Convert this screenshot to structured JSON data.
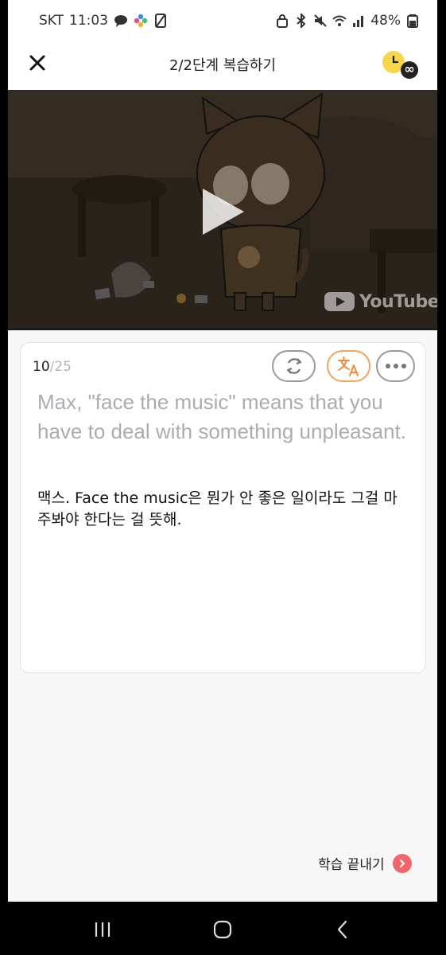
{
  "status_bar": {
    "carrier": "SKT",
    "time": "11:03",
    "battery": "48%"
  },
  "header": {
    "title": "2/2단계 복습하기",
    "timer_symbol": "∞"
  },
  "video": {
    "brand": "YouTube",
    "progress": 0
  },
  "card": {
    "counter_current": "10",
    "counter_total": "/25",
    "english": "Max, \"face the music\" means that you have to deal with something unpleasant.",
    "korean": "맥스. Face the music은 뭔가 안 좋은 일이라도 그걸 마주봐야 한다는 걸 뜻해."
  },
  "footer": {
    "finish_label": "학습 끝내기"
  },
  "colors": {
    "accent_orange": "#f5a45d",
    "accent_red": "#f2656b",
    "timer_yellow": "#f7d64a"
  }
}
